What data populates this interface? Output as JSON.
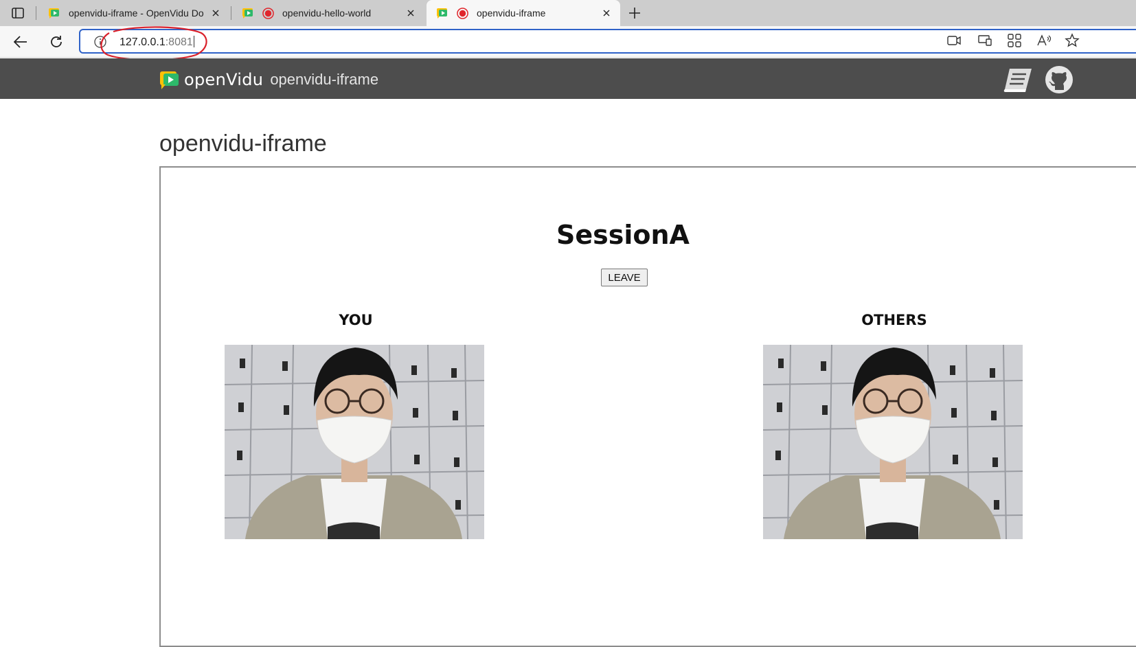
{
  "browser": {
    "tabs": [
      {
        "title": "openvidu-iframe - OpenVidu Do",
        "recording": false,
        "active": false
      },
      {
        "title": "openvidu-hello-world",
        "recording": true,
        "active": false
      },
      {
        "title": "openvidu-iframe",
        "recording": true,
        "active": true
      }
    ],
    "address": {
      "host": "127.0.0.1",
      "port": ":8081"
    },
    "icons": {
      "tab_actions": "tab-actions-icon",
      "back": "back-arrow-icon",
      "reload": "reload-icon",
      "site_info": "info-icon",
      "camera": "camera-icon",
      "cast": "cast-icon",
      "apps": "apps-icon",
      "read_aloud": "read-aloud-icon",
      "favorite": "favorite-star-icon"
    },
    "annotation_color": "#d9202a"
  },
  "navbar": {
    "brand_name": "openVidu",
    "brand_subtitle": "openvidu-iframe",
    "icons": [
      "docs-book-icon",
      "github-icon"
    ],
    "background": "#4d4d4d"
  },
  "page": {
    "title": "openvidu-iframe",
    "session": {
      "name": "SessionA",
      "leave_label": "LEAVE",
      "you_label": "YOU",
      "others_label": "OTHERS"
    }
  },
  "colors": {
    "tabstrip": "#cdcdcd",
    "omnibox_border": "#2f62c8",
    "recording_red": "#e0262c",
    "openvidu_yellow": "#ffc107",
    "openvidu_green": "#2db96a"
  }
}
